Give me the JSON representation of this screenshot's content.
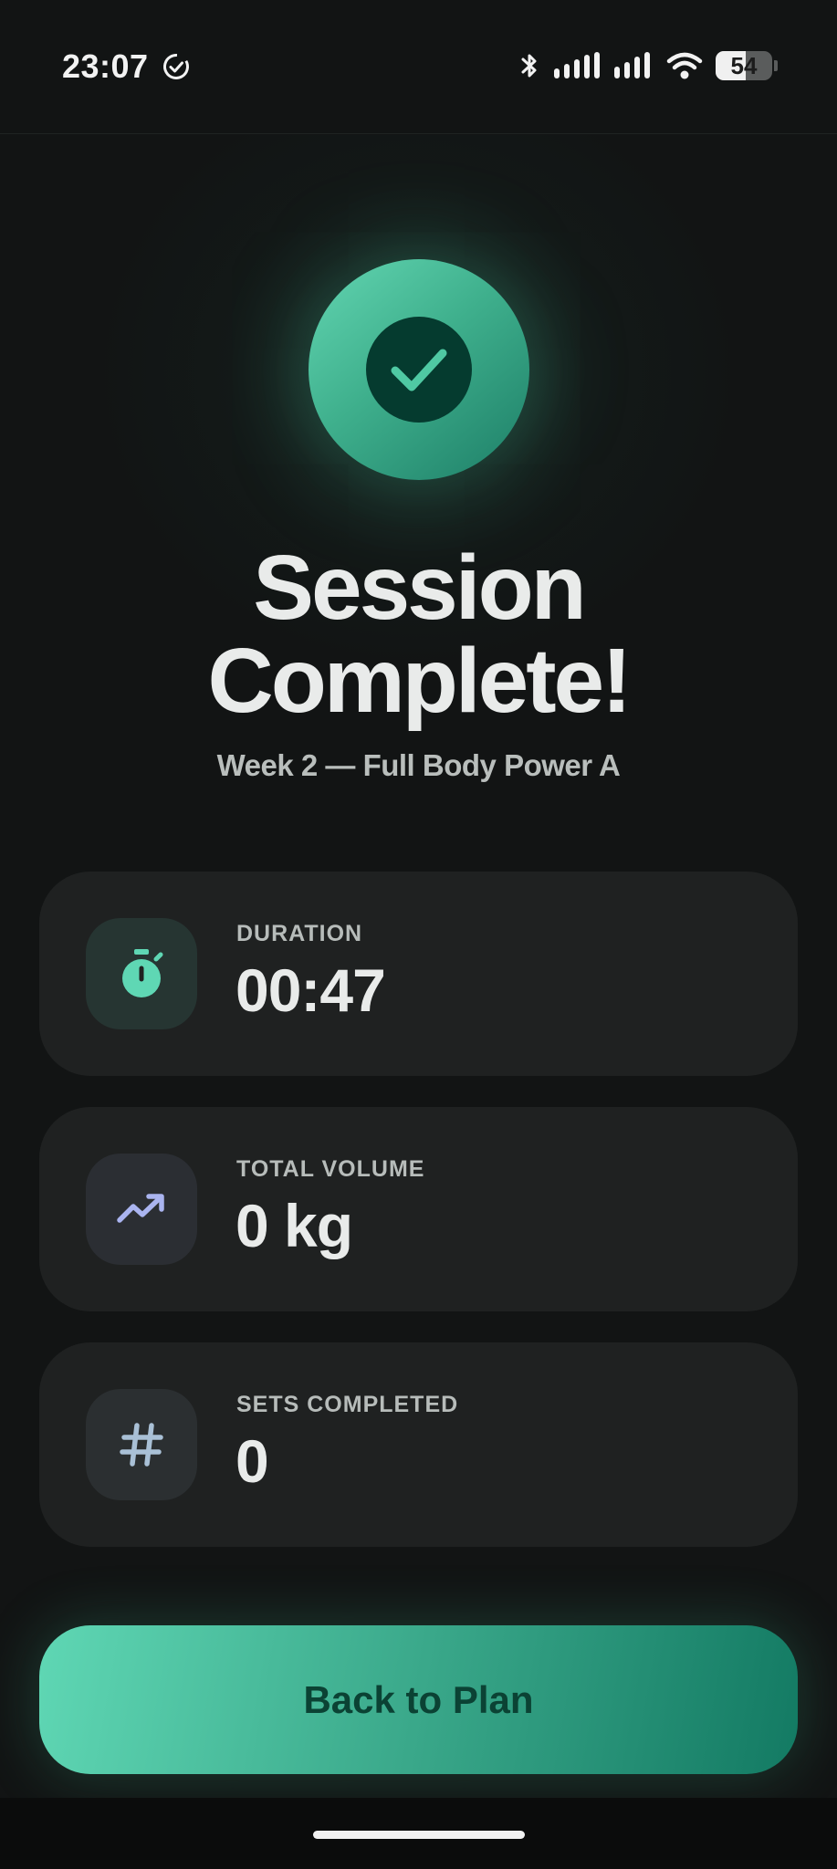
{
  "status_bar": {
    "time": "23:07",
    "battery_level": "54",
    "battery_fraction": 0.54
  },
  "hero": {
    "icon": "checkmark-icon",
    "title_line1": "Session",
    "title_line2": "Complete!",
    "subtitle": "Week 2 — Full Body Power A"
  },
  "stats": [
    {
      "label": "DURATION",
      "value": "00:47",
      "icon": "stopwatch-icon"
    },
    {
      "label": "TOTAL VOLUME",
      "value": "0 kg",
      "icon": "trending-up-icon"
    },
    {
      "label": "SETS COMPLETED",
      "value": "0",
      "icon": "hash-icon"
    }
  ],
  "actions": {
    "back_label": "Back to Plan"
  },
  "colors": {
    "accent": "#4fc9a3",
    "accent_dark": "#137a63",
    "background": "#121414",
    "card": "#1f2121",
    "volume_icon": "#aab4f0",
    "hash_icon": "#a9c0d6"
  }
}
